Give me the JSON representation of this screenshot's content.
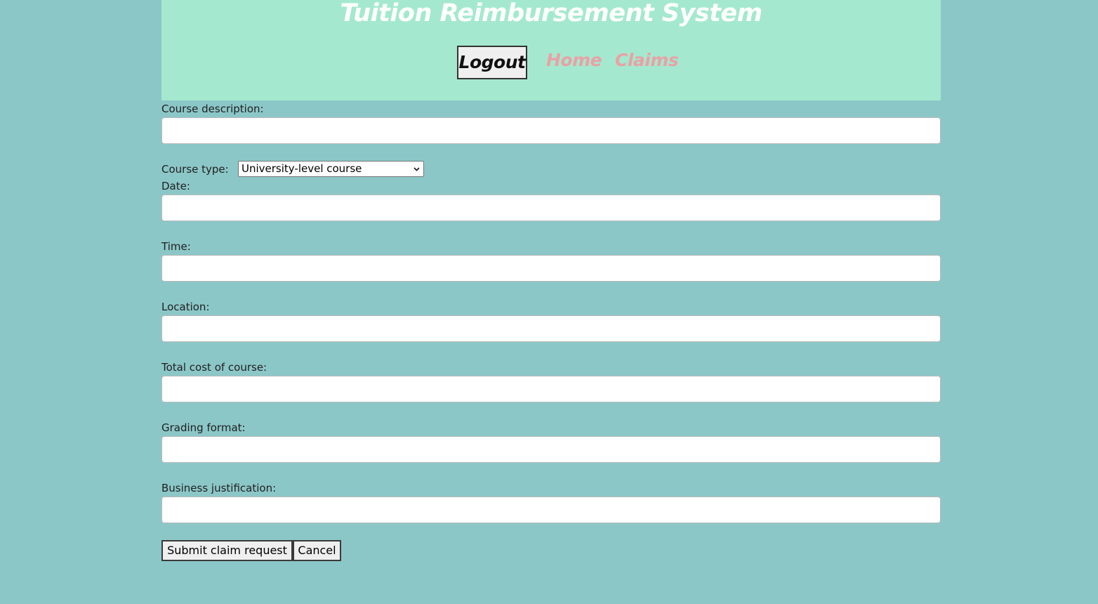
{
  "header": {
    "title": "Tuition Reimbursement System",
    "nav": {
      "logout_label": "Logout",
      "home_label": "Home",
      "claims_label": "Claims"
    }
  },
  "form": {
    "course_description": {
      "label": "Course description:",
      "value": ""
    },
    "course_type": {
      "label": "Course type:",
      "selected": "University-level course"
    },
    "date": {
      "label": "Date:",
      "value": ""
    },
    "time": {
      "label": "Time:",
      "value": ""
    },
    "location": {
      "label": "Location:",
      "value": ""
    },
    "total_cost": {
      "label": "Total cost of course:",
      "value": ""
    },
    "grading_format": {
      "label": "Grading format:",
      "value": ""
    },
    "business_justification": {
      "label": "Business justification:",
      "value": ""
    },
    "submit_label": "Submit claim request",
    "cancel_label": "Cancel"
  },
  "colors": {
    "page_background": "#8cc7c8",
    "header_background": "#a4e9cf",
    "title_color": "#ffffff",
    "nav_link_color": "#e8a2a6"
  },
  "icons": {
    "select_arrow": "chevron-down-icon"
  }
}
